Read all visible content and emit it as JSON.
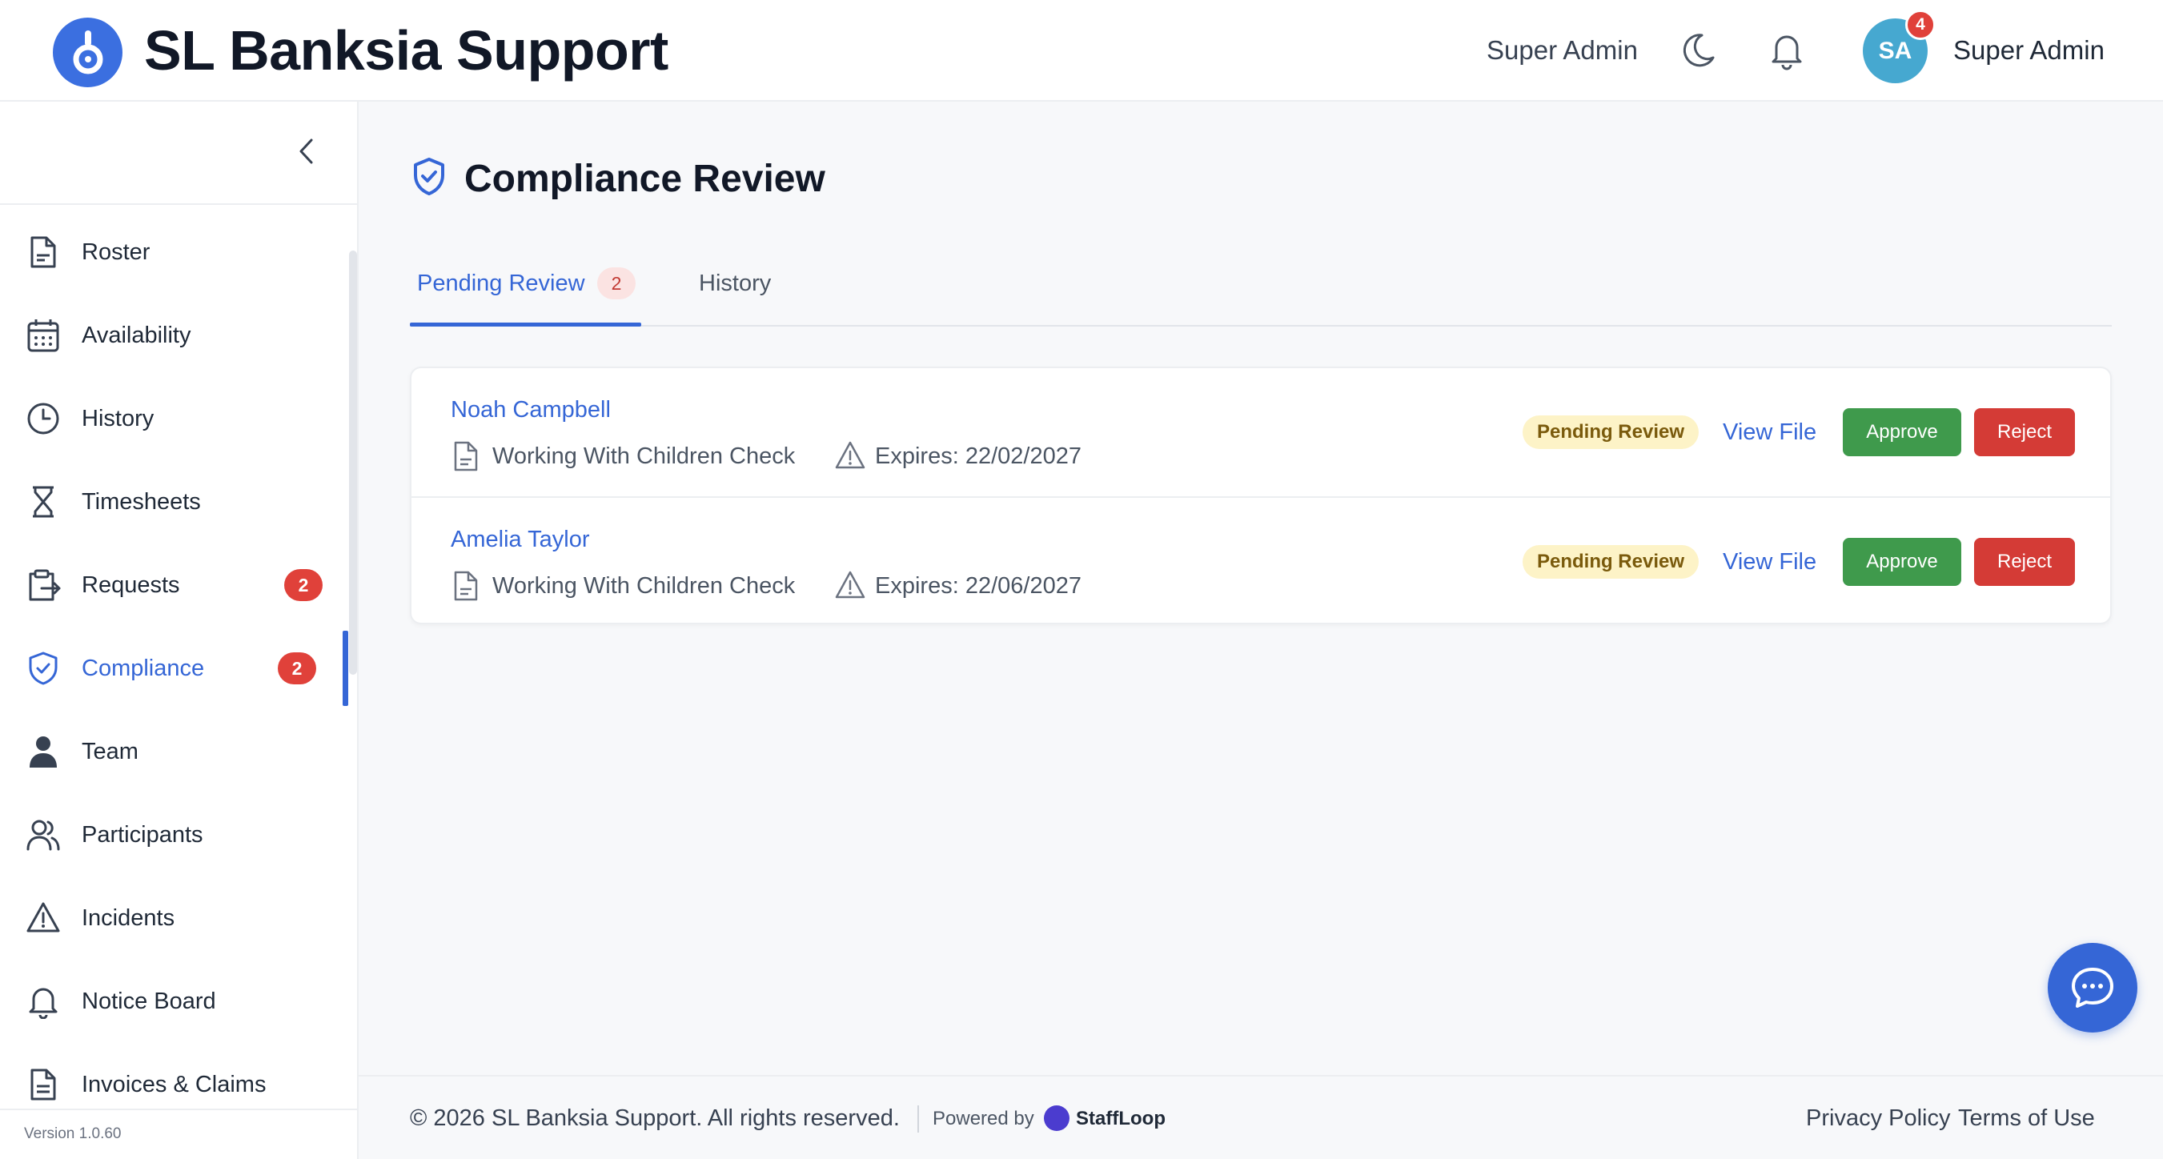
{
  "header": {
    "title": "SL Banksia Support",
    "role": "Super Admin",
    "avatar_initials": "SA",
    "notification_count": "4",
    "user_name": "Super Admin"
  },
  "sidebar": {
    "items": [
      {
        "label": "Roster",
        "icon": "document-icon"
      },
      {
        "label": "Availability",
        "icon": "calendar-icon"
      },
      {
        "label": "History",
        "icon": "clock-icon"
      },
      {
        "label": "Timesheets",
        "icon": "hourglass-icon"
      },
      {
        "label": "Requests",
        "icon": "clipboard-export-icon",
        "badge": "2"
      },
      {
        "label": "Compliance",
        "icon": "shield-check-icon",
        "badge": "2",
        "active": true
      },
      {
        "label": "Team",
        "icon": "person-icon"
      },
      {
        "label": "Participants",
        "icon": "people-icon"
      },
      {
        "label": "Incidents",
        "icon": "warning-icon"
      },
      {
        "label": "Notice Board",
        "icon": "bell-icon"
      },
      {
        "label": "Invoices & Claims",
        "icon": "invoice-icon"
      }
    ],
    "version": "Version 1.0.60"
  },
  "main": {
    "title": "Compliance Review",
    "tabs": [
      {
        "label": "Pending Review",
        "count": "2",
        "active": true
      },
      {
        "label": "History"
      }
    ],
    "rows": [
      {
        "name": "Noah Campbell",
        "document": "Working With Children Check",
        "expires": "Expires: 22/02/2027",
        "status": "Pending Review",
        "view_label": "View File",
        "approve_label": "Approve",
        "reject_label": "Reject"
      },
      {
        "name": "Amelia Taylor",
        "document": "Working With Children Check",
        "expires": "Expires: 22/06/2027",
        "status": "Pending Review",
        "view_label": "View File",
        "approve_label": "Approve",
        "reject_label": "Reject"
      }
    ]
  },
  "footer": {
    "copyright": "© 2026 SL Banksia Support. All rights reserved.",
    "powered_by": "Powered by",
    "powered_brand": "StaffLoop",
    "privacy": "Privacy Policy",
    "terms": "Terms of Use"
  },
  "colors": {
    "accent": "#3566d6",
    "approve": "#3f9a4c",
    "reject": "#d43b36",
    "badge": "#e0413a",
    "pending_pill": "#fdf3c7"
  }
}
